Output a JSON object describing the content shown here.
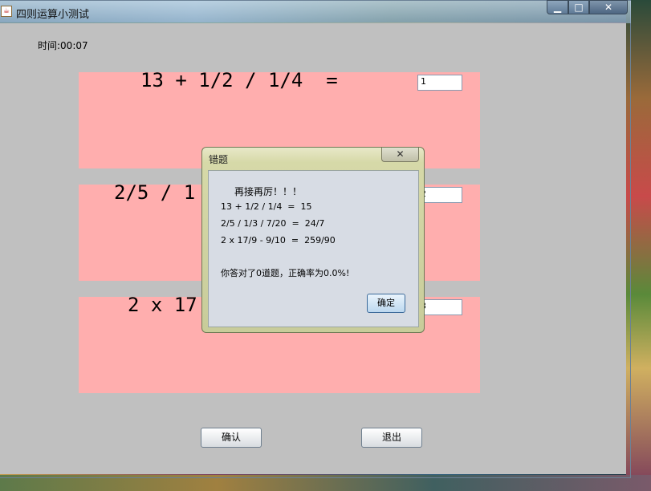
{
  "window": {
    "title": "四则运算小测试",
    "min_symbol": "▁",
    "max_symbol": "□",
    "close_symbol": "✕"
  },
  "timer": {
    "text": "时间:00:07"
  },
  "questions": [
    {
      "expression": "13 + 1/2 / 1/4  =",
      "answer": "1"
    },
    {
      "expression": "2/5 / 1",
      "answer": "2"
    },
    {
      "expression": "2 x 17",
      "answer": "3"
    }
  ],
  "buttons": {
    "confirm": "确认",
    "exit": "退出"
  },
  "dialog": {
    "title": "错题",
    "close_symbol": "✕",
    "heading": "再接再厉！！！",
    "lines": [
      "13 + 1/2 / 1/4  =  15",
      "2/5 / 1/3 / 7/20  =  24/7",
      "2 x 17/9 - 9/10  =  259/90"
    ],
    "result": "你答对了0道题，正确率为0.0%!",
    "ok_label": "确定"
  },
  "colors": {
    "question_panel": "#ffaeae",
    "client_bg": "#c0c0c0"
  }
}
